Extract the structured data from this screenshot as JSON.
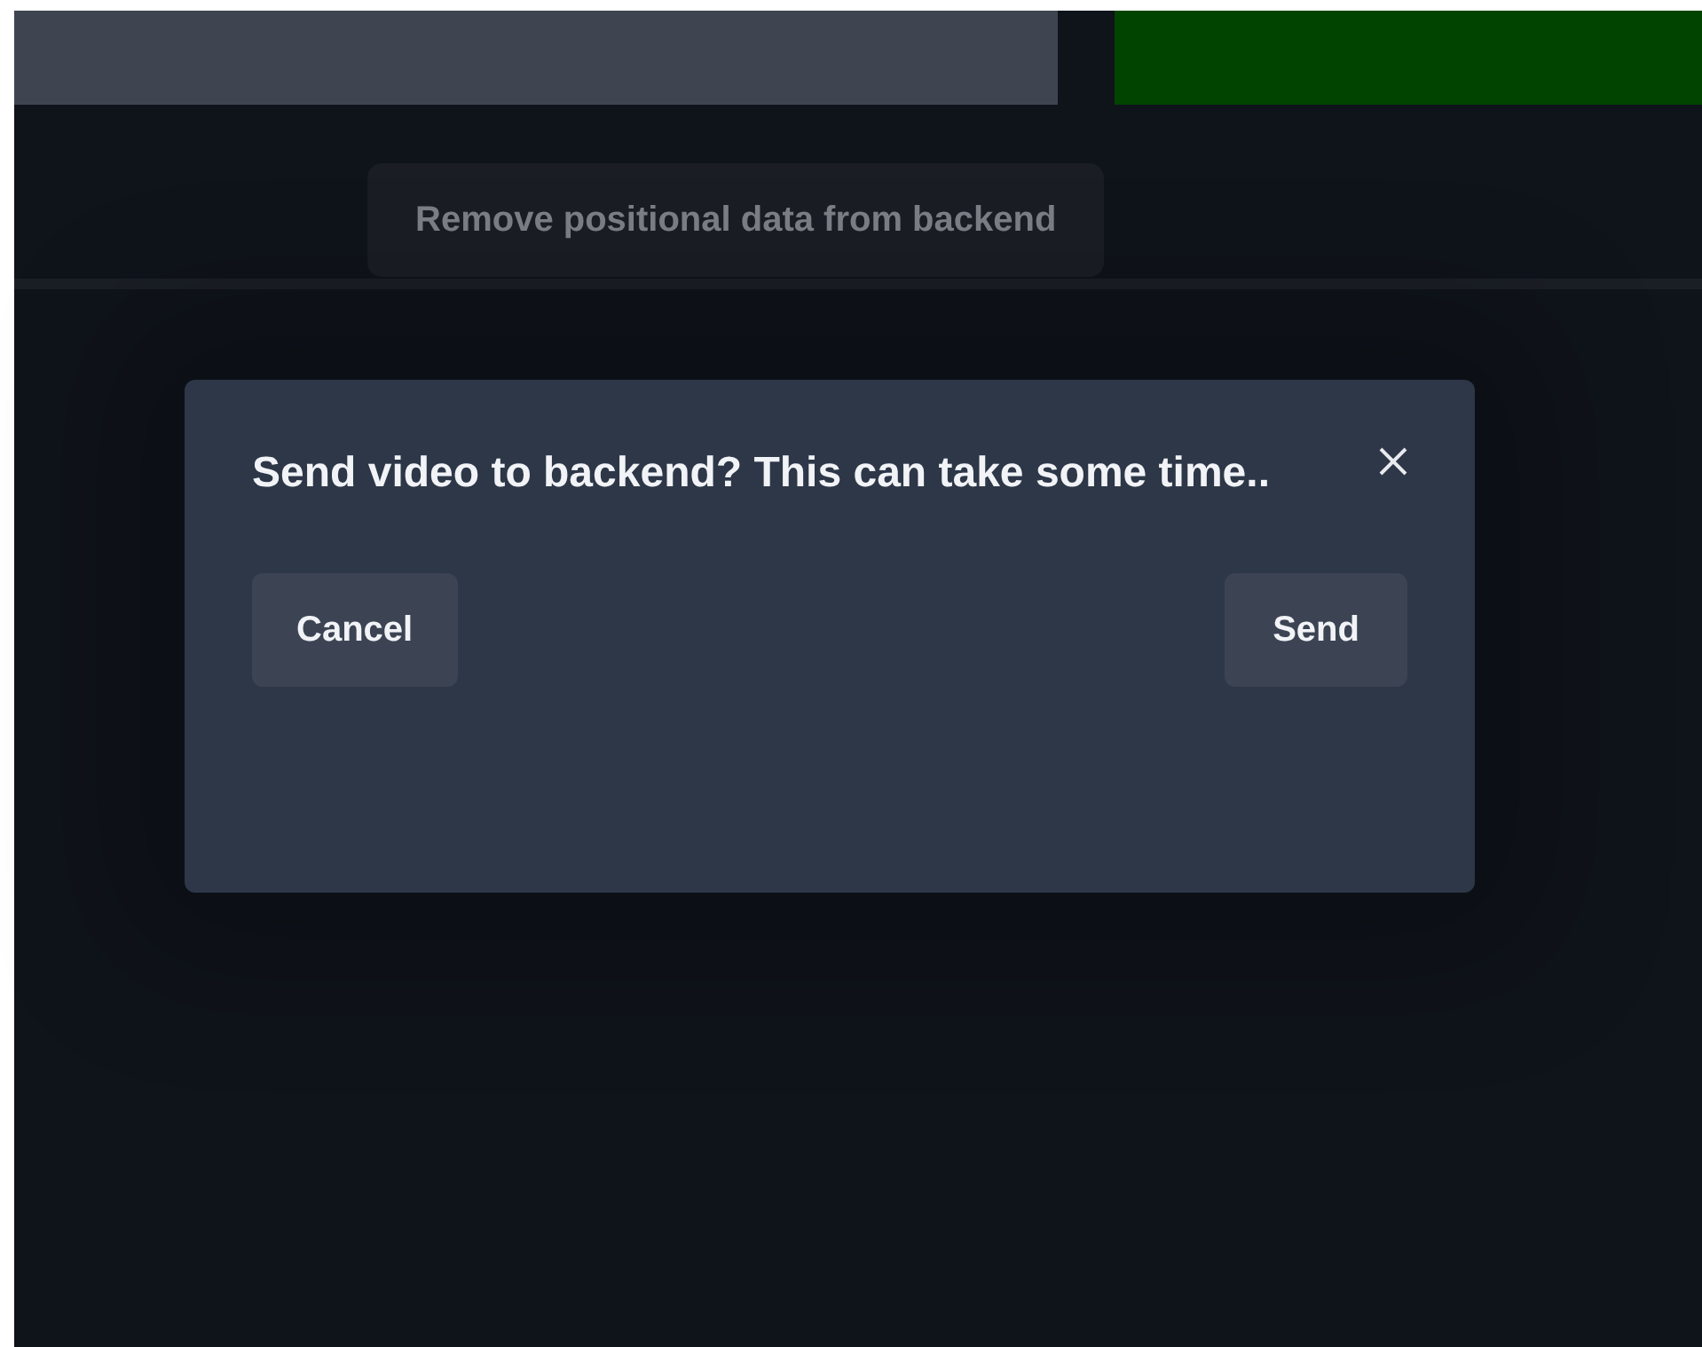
{
  "top_action": {
    "label": "Remove positional data from backend",
    "disabled": true
  },
  "dialog": {
    "message": "Send video to backend? This can take some time..",
    "buttons": [
      {
        "label": "Cancel",
        "kind": "secondary"
      },
      {
        "label": "Send",
        "kind": "primary"
      }
    ]
  }
}
